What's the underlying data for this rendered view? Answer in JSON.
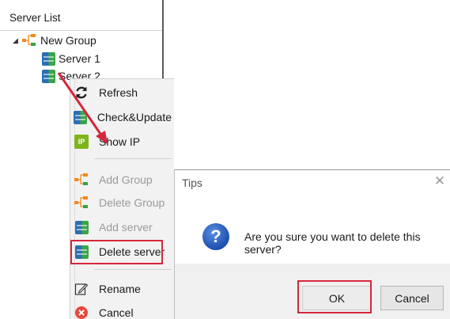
{
  "panel": {
    "title": "Server List",
    "group": {
      "label": "New Group",
      "expanded": true
    },
    "servers": [
      {
        "label": "Server 1"
      },
      {
        "label": "Server 2"
      }
    ]
  },
  "context_menu": {
    "items": [
      {
        "label": "Refresh",
        "icon": "refresh-icon",
        "enabled": true
      },
      {
        "label": "Check&Update",
        "icon": "server-icon",
        "enabled": true
      },
      {
        "label": "Show IP",
        "icon": "ip-icon",
        "enabled": true
      },
      {
        "label": "Add Group",
        "icon": "group-icon",
        "enabled": false
      },
      {
        "label": "Delete Group",
        "icon": "group-icon",
        "enabled": false
      },
      {
        "label": "Add server",
        "icon": "server-icon",
        "enabled": false
      },
      {
        "label": "Delete server",
        "icon": "server-icon",
        "enabled": true,
        "highlighted": true
      },
      {
        "label": "Rename",
        "icon": "rename-icon",
        "enabled": true
      },
      {
        "label": "Cancel",
        "icon": "cancel-icon",
        "enabled": true
      }
    ],
    "ip_badge_text": "IP"
  },
  "dialog": {
    "title": "Tips",
    "close_glyph": "✕",
    "icon": "question-icon",
    "icon_glyph": "?",
    "message": "Are you sure you want to delete this server?",
    "ok_label": "OK",
    "cancel_label": "Cancel",
    "ok_highlighted": true
  },
  "colors": {
    "highlight": "#d6263a",
    "server_blue": "#2b6fb3",
    "server_green": "#3aa547",
    "group_orange": "#f08a1c",
    "group_green": "#35a346"
  }
}
